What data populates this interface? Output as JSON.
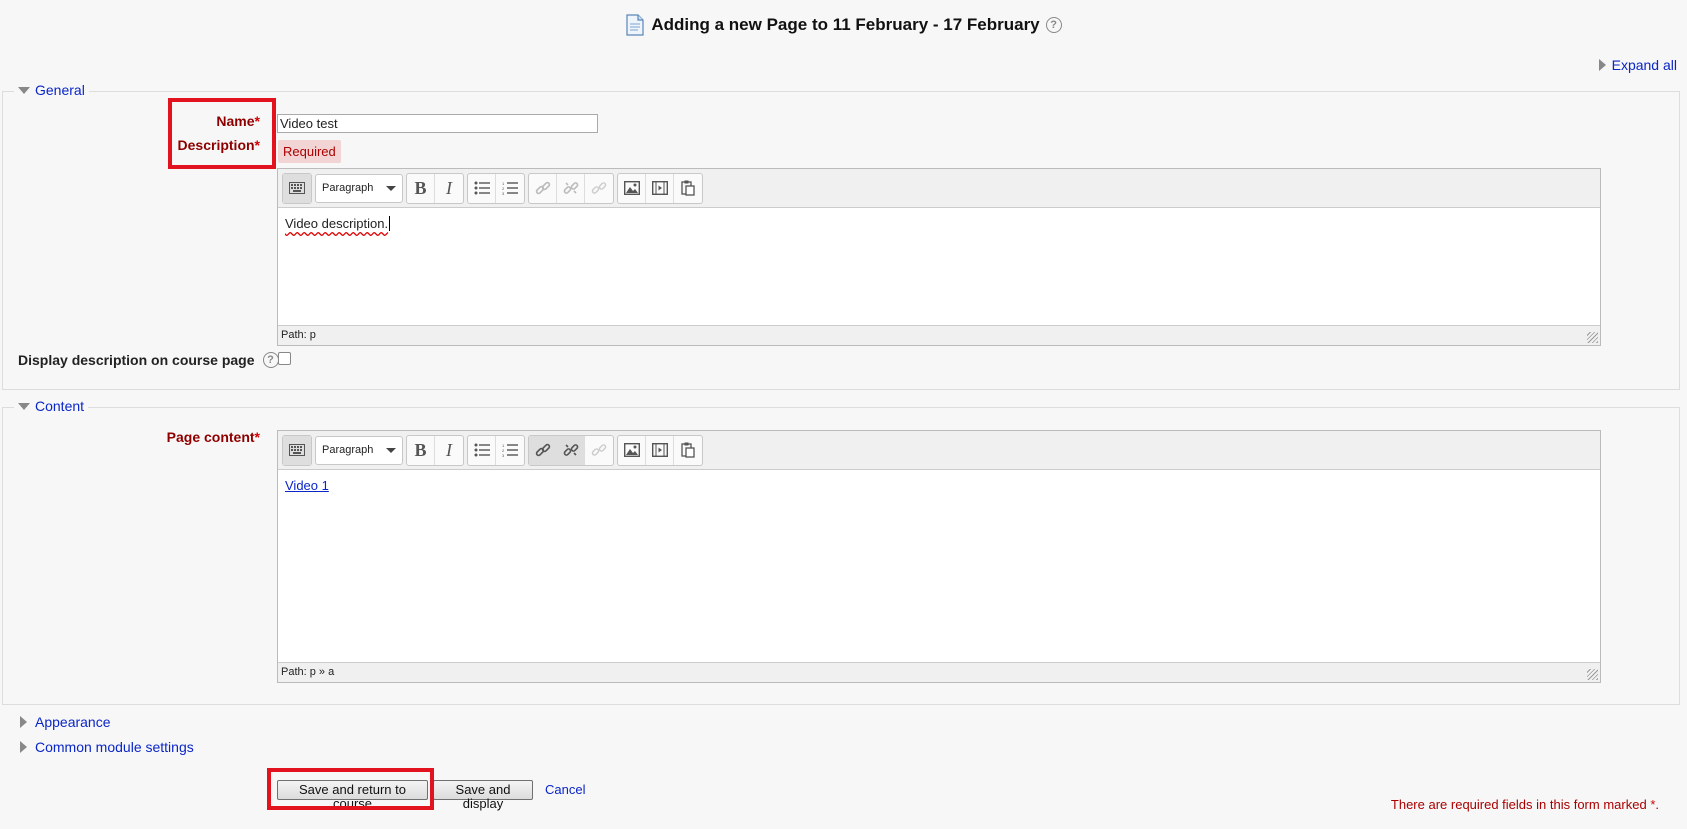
{
  "header": {
    "title": "Adding a new Page to 11 February - 17 February"
  },
  "expand_all": "Expand all",
  "general": {
    "legend": "General",
    "name_label": "Name",
    "name_value": "Video test",
    "description_label": "Description",
    "required_tag": "Required",
    "editor": {
      "format_select": "Paragraph",
      "content": "Video description.",
      "path": "Path: p"
    },
    "display_desc_label": "Display description on course page",
    "display_desc_checked": false
  },
  "content": {
    "legend": "Content",
    "page_content_label": "Page content",
    "editor": {
      "format_select": "Paragraph",
      "link_text": "Video 1",
      "path": "Path: p » a"
    }
  },
  "collapsed_sections": [
    "Appearance",
    "Common module settings"
  ],
  "buttons": {
    "save_return": "Save and return to course",
    "save_display": "Save and display",
    "cancel": "Cancel"
  },
  "required_note": "There are required fields in this form marked",
  "required_mark": "*",
  "colors": {
    "link": "#0a25c8",
    "required_label": "#8e0000",
    "highlight_box": "#e2121e"
  },
  "icons": [
    "page-icon",
    "help-icon",
    "expand-arrow-icon",
    "collapse-arrow-icon",
    "toolbar-toggle-icon",
    "bold-icon",
    "italic-icon",
    "bullet-list-icon",
    "numbered-list-icon",
    "link-icon",
    "unlink-icon",
    "anchor-icon",
    "image-icon",
    "media-icon",
    "paste-icon",
    "resize-grip-icon"
  ]
}
